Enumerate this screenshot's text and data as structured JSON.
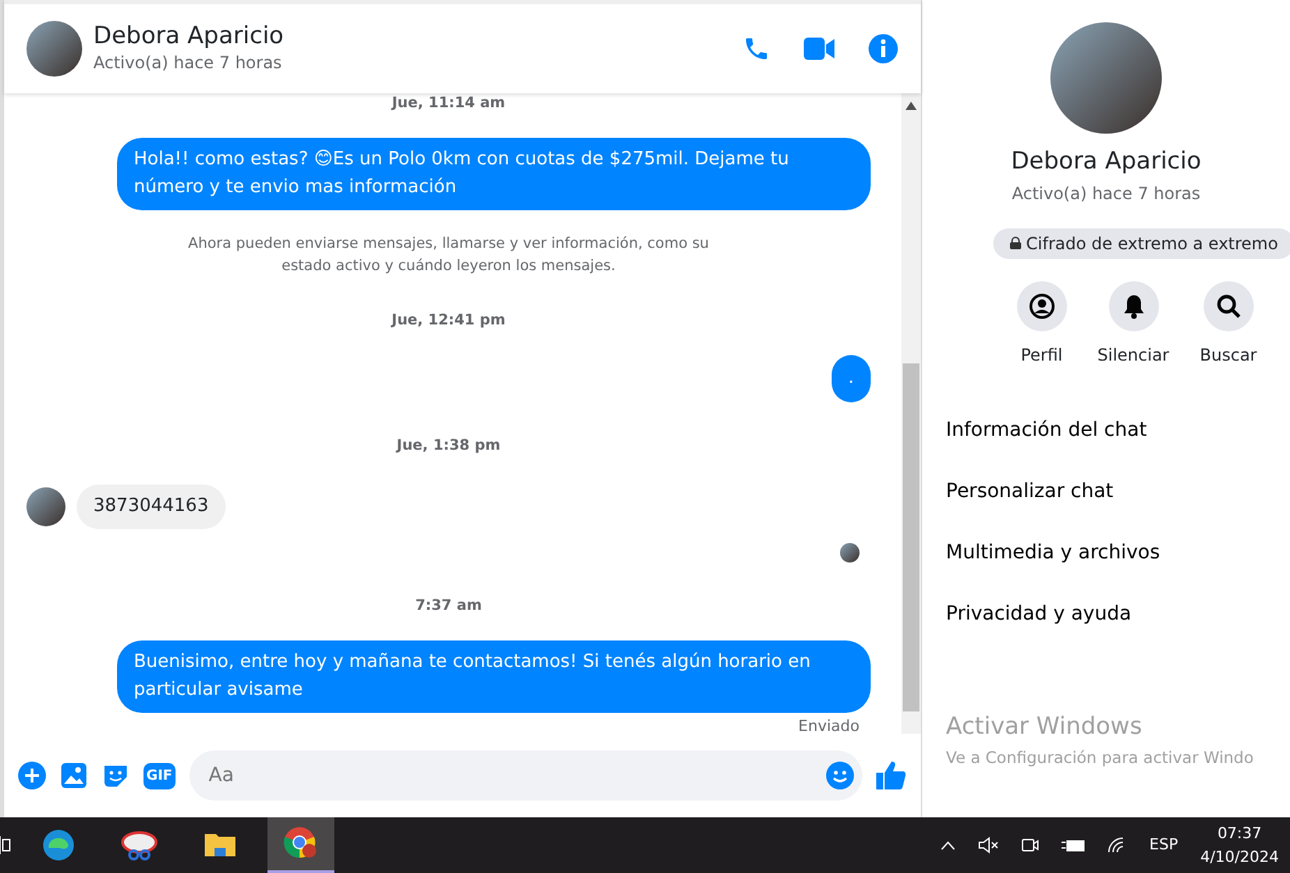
{
  "chat": {
    "contact": {
      "name": "Debora Aparicio",
      "status": "Activo(a) hace 7 horas"
    },
    "messages": [
      {
        "kind": "timestamp",
        "text": "Jue, 11:14 am"
      },
      {
        "kind": "outgoing",
        "text": "Hola!! como estas? 😊Es un Polo 0km con cuotas de $275mil. Dejame tu número y te envio mas información"
      },
      {
        "kind": "system",
        "text": "Ahora pueden enviarse mensajes, llamarse y ver información, como su estado activo y cuándo leyeron los mensajes."
      },
      {
        "kind": "timestamp",
        "text": "Jue, 12:41 pm"
      },
      {
        "kind": "outgoing",
        "text": "."
      },
      {
        "kind": "timestamp",
        "text": "Jue, 1:38 pm"
      },
      {
        "kind": "incoming",
        "text": "3873044163"
      },
      {
        "kind": "seen"
      },
      {
        "kind": "timestamp",
        "text": "7:37 am"
      },
      {
        "kind": "outgoing",
        "text": "Buenisimo, entre hoy y mañana te contactamos! Si tenés algún horario en particular avisame"
      }
    ],
    "delivery_status": "Enviado",
    "composer": {
      "gif_label": "GIF",
      "placeholder": "Aa"
    }
  },
  "info": {
    "name": "Debora Aparicio",
    "status": "Activo(a) hace 7 horas",
    "encryption": "Cifrado de extremo a extremo",
    "actions": [
      {
        "kind": "profile",
        "label": "Perfil"
      },
      {
        "kind": "mute",
        "label": "Silenciar"
      },
      {
        "kind": "search",
        "label": "Buscar"
      }
    ],
    "menu": [
      "Información del chat",
      "Personalizar chat",
      "Multimedia y archivos",
      "Privacidad y ayuda"
    ]
  },
  "watermark": {
    "title": "Activar Windows",
    "text": "Ve a Configuración para activar Windo"
  },
  "taskbar": {
    "apps": [
      {
        "kind": "taskview",
        "selected": false
      },
      {
        "kind": "edge",
        "selected": false
      },
      {
        "kind": "snip",
        "selected": false
      },
      {
        "kind": "explorer",
        "selected": false
      },
      {
        "kind": "chrome",
        "selected": true
      }
    ],
    "language": "ESP",
    "time": "07:37",
    "date": "4/10/2024"
  }
}
